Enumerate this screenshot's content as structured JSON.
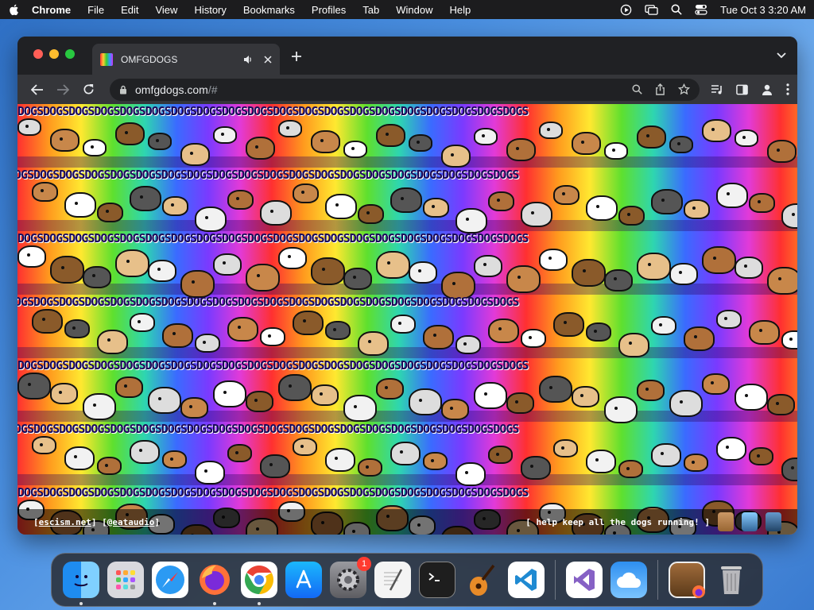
{
  "menubar": {
    "app_name": "Chrome",
    "items": [
      "File",
      "Edit",
      "View",
      "History",
      "Bookmarks",
      "Profiles",
      "Tab",
      "Window",
      "Help"
    ],
    "clock": "Tue Oct 3  3:20 AM"
  },
  "browser": {
    "tab_title": "OMFGDOGS",
    "url_host": "omfgdogs.com",
    "url_path": "/#"
  },
  "page": {
    "dog_word": "DOGSDOGSDOGSDOGSDOGSDOGSDOGSDOGSDOGSDOGSDOGSDOGSDOGSDOGSDOGSDOGSDOGSDOGSDOGSDOGS",
    "footer_left_open": "[ ",
    "link_escism": "escism.net",
    "footer_sep": " ] [ ",
    "link_eataudio": "@eataudio",
    "footer_left_close": " ]",
    "footer_right": "[ help keep all the dogs running! ]"
  },
  "dock": {
    "apps": [
      "finder",
      "launchpad",
      "safari",
      "firefox",
      "chrome",
      "app-store",
      "system-settings",
      "textedit",
      "terminal",
      "garageband",
      "vscode",
      "visual-studio",
      "weather",
      "preview",
      "trash"
    ],
    "settings_badge": "1"
  },
  "colors": {
    "menubar_bg": "#1c1c1e",
    "window_bg": "#202124",
    "toolbar_bg": "#35363a"
  }
}
